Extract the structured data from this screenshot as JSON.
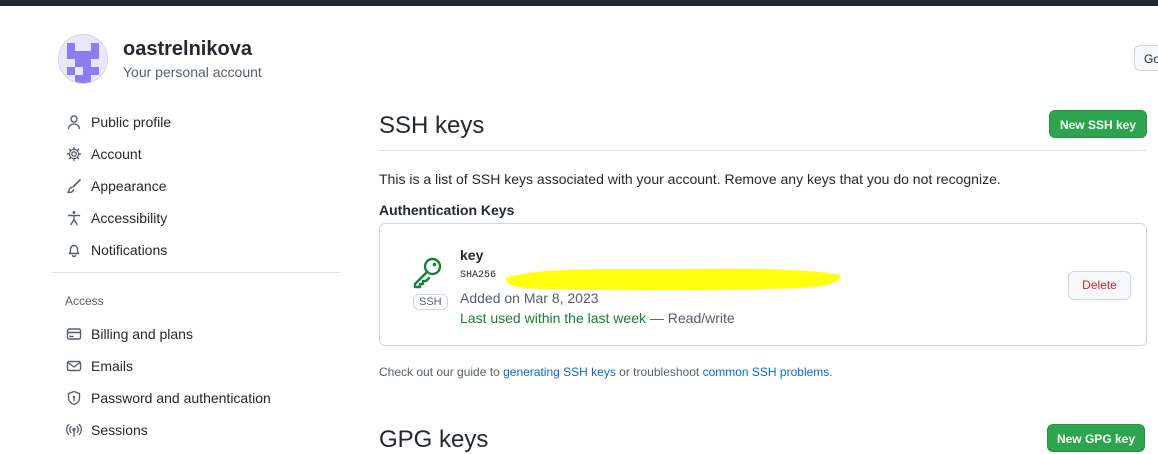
{
  "account": {
    "username": "oastrelnikova",
    "subtitle": "Your personal account",
    "goto_label": "Go"
  },
  "sidebar": {
    "items": [
      {
        "label": "Public profile",
        "icon": "person-icon"
      },
      {
        "label": "Account",
        "icon": "gear-icon"
      },
      {
        "label": "Appearance",
        "icon": "paintbrush-icon"
      },
      {
        "label": "Accessibility",
        "icon": "accessibility-icon"
      },
      {
        "label": "Notifications",
        "icon": "bell-icon"
      }
    ],
    "section_title": "Access",
    "access_items": [
      {
        "label": "Billing and plans",
        "icon": "credit-card-icon"
      },
      {
        "label": "Emails",
        "icon": "mail-icon"
      },
      {
        "label": "Password and authentication",
        "icon": "shield-lock-icon"
      },
      {
        "label": "Sessions",
        "icon": "broadcast-icon"
      }
    ]
  },
  "main": {
    "title": "SSH keys",
    "new_button": "New SSH key",
    "description": "This is a list of SSH keys associated with your account. Remove any keys that you do not recognize.",
    "auth_heading": "Authentication Keys",
    "keys": [
      {
        "title": "key",
        "fingerprint_prefix": "SHA256",
        "type_label": "SSH",
        "added": "Added on Mar 8, 2023",
        "last_used": "Last used within the last week",
        "access": "— Read/write",
        "delete_label": "Delete"
      }
    ],
    "guide": {
      "prefix": "Check out our guide to",
      "link1": "generating SSH keys",
      "middle": "or troubleshoot",
      "link2": "common SSH problems",
      "suffix": "."
    },
    "next_section": {
      "title": "GPG keys",
      "new_button": "New GPG key"
    }
  },
  "colors": {
    "primary_button": "#2da44e",
    "link": "#0969da",
    "danger": "#cf222e",
    "success_text": "#1a7f37",
    "redaction": "#ffff00"
  }
}
